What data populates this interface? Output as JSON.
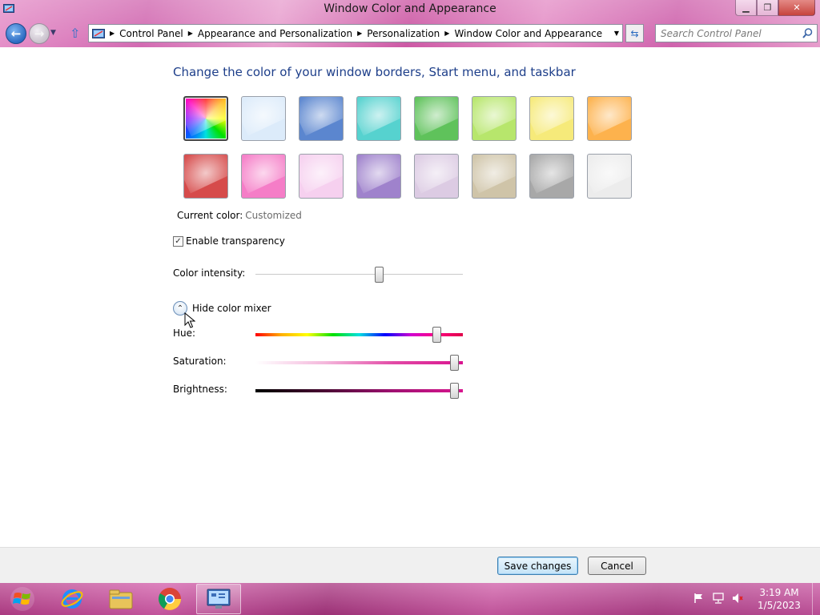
{
  "window": {
    "title": "Window Color and Appearance",
    "minimize_icon": "minimize-icon",
    "restore_icon": "restore-icon",
    "close_icon": "close-icon"
  },
  "navigation": {
    "back_icon": "back-arrow-icon",
    "forward_icon": "forward-arrow-icon",
    "up_icon": "up-arrow-icon",
    "breadcrumbs": [
      "Control Panel",
      "Appearance and Personalization",
      "Personalization",
      "Window Color and Appearance"
    ],
    "search_placeholder": "Search Control Panel"
  },
  "content": {
    "heading": "Change the color of your window borders, Start menu, and taskbar",
    "swatches": [
      {
        "name": "rainbow",
        "color": "conic",
        "selected": true
      },
      {
        "name": "sky",
        "color": "#dcebfa"
      },
      {
        "name": "twilight",
        "color": "#5b86cf"
      },
      {
        "name": "sea",
        "color": "#56d2cf"
      },
      {
        "name": "leaf",
        "color": "#5fc25b"
      },
      {
        "name": "lime",
        "color": "#b7e66c"
      },
      {
        "name": "lemon",
        "color": "#f6ea7a"
      },
      {
        "name": "tangerine",
        "color": "#fdb24d"
      },
      {
        "name": "ruby",
        "color": "#d64b4b"
      },
      {
        "name": "fuchsia",
        "color": "#f57dc7"
      },
      {
        "name": "blush",
        "color": "#f6d0ef"
      },
      {
        "name": "violet",
        "color": "#9f82cc"
      },
      {
        "name": "lavender",
        "color": "#dccbe3"
      },
      {
        "name": "taupe",
        "color": "#cfc4a8"
      },
      {
        "name": "chocolate",
        "color": "#a8a8a8"
      },
      {
        "name": "slate",
        "color": "#ececec"
      }
    ],
    "current_color_label": "Current color:",
    "current_color_value": "Customized",
    "transparency_label": "Enable transparency",
    "transparency_checked": true,
    "intensity_label": "Color intensity:",
    "intensity_value": 0.6,
    "mixer_toggle_label": "Hide color mixer",
    "hue_label": "Hue:",
    "hue_value": 0.89,
    "saturation_label": "Saturation:",
    "saturation_value": 0.98,
    "brightness_label": "Brightness:",
    "brightness_value": 0.98
  },
  "footer": {
    "save_label": "Save changes",
    "cancel_label": "Cancel"
  },
  "taskbar": {
    "start_icon": "windows-logo-icon",
    "items": [
      {
        "name": "internet-explorer-icon",
        "active": false
      },
      {
        "name": "file-explorer-icon",
        "active": false
      },
      {
        "name": "chrome-icon",
        "active": false
      },
      {
        "name": "control-panel-icon",
        "active": true
      }
    ],
    "tray_icons": [
      "action-center-flag-icon",
      "network-icon",
      "volume-muted-icon"
    ],
    "time": "3:19 AM",
    "date": "1/5/2023"
  }
}
